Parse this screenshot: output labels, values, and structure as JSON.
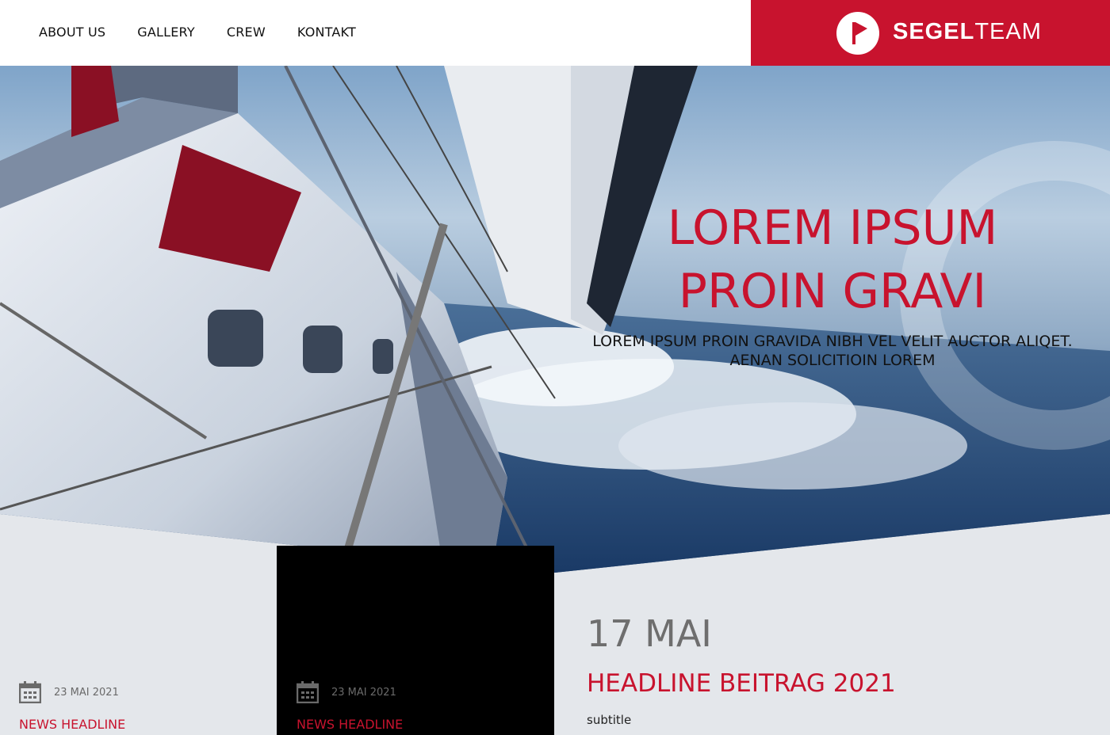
{
  "nav": {
    "items": [
      "ABOUT US",
      "GALLERY",
      "CREW",
      "KONTAKT"
    ]
  },
  "brand": {
    "bold": "SEGEL",
    "light": "TEAM",
    "color": "#c8132e"
  },
  "hero": {
    "title_line1": "LOREM IPSUM",
    "title_line2": "PROIN GRAVI",
    "sub_line1": "LOREM IPSUM PROIN GRAVIDA NIBH VEL VELIT AUCTOR ALIQET.",
    "sub_line2": "AENAN SOLICITIOIN LOREM"
  },
  "news": [
    {
      "date": "23 MAI 2021",
      "headline": "NEWS HEADLINE",
      "icon": "calendar-icon"
    },
    {
      "date": "23 MAI 2021",
      "headline": "NEWS HEADLINE",
      "icon": "calendar-icon"
    }
  ],
  "feature": {
    "date": "17 MAI",
    "headline": "HEADLINE BEITRAG 2021",
    "subtitle": "subtitle"
  }
}
